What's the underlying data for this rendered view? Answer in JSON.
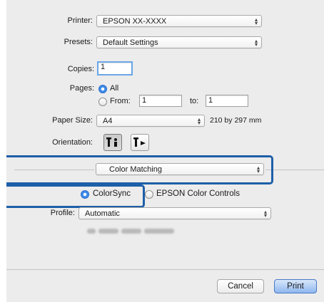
{
  "printer": {
    "label": "Printer:",
    "value": "EPSON XX-XXXX"
  },
  "presets": {
    "label": "Presets:",
    "value": "Default Settings"
  },
  "copies": {
    "label": "Copies:",
    "value": "1"
  },
  "pages": {
    "label": "Pages:",
    "all_label": "All",
    "from_label": "From:",
    "from_value": "1",
    "to_label": "to:",
    "to_value": "1",
    "selected": "All"
  },
  "paper_size": {
    "label": "Paper Size:",
    "value": "A4",
    "dimensions": "210 by 297 mm"
  },
  "orientation": {
    "label": "Orientation:",
    "selected": "portrait",
    "options": [
      "portrait-icon",
      "landscape-icon"
    ]
  },
  "section": {
    "value": "Color Matching"
  },
  "color_mode": {
    "colorsync_label": "ColorSync",
    "epson_label": "EPSON Color Controls",
    "selected": "ColorSync"
  },
  "profile": {
    "label": "Profile:",
    "value": "Automatic"
  },
  "buttons": {
    "cancel": "Cancel",
    "print": "Print"
  },
  "colors": {
    "highlight": "#1d5fa8",
    "selected_radio": "#3d8bea",
    "default_button": "#8fb7ee"
  }
}
